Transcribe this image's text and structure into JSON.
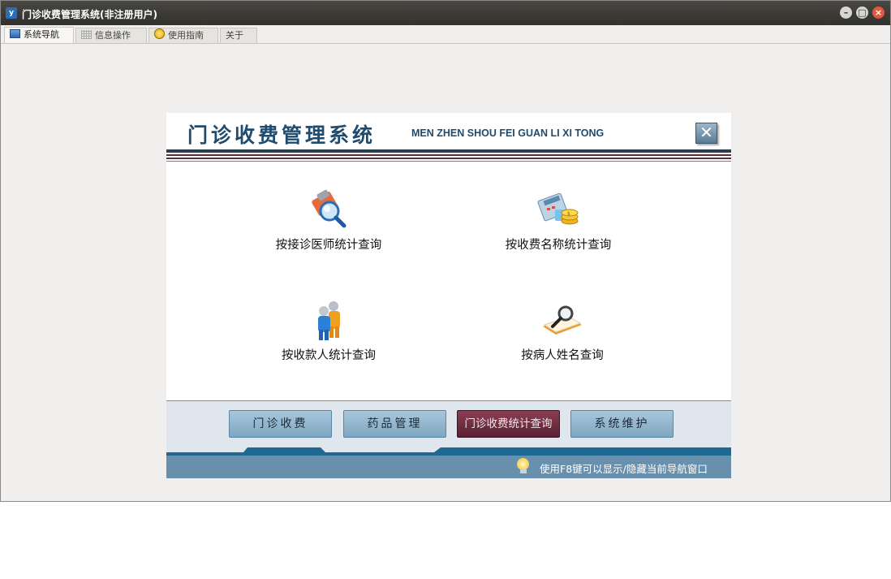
{
  "window": {
    "title": "门诊收费管理系统(非注册用户)",
    "logo_text": "y"
  },
  "tabs": [
    {
      "label": "系统导航",
      "icon": "monitor-icon",
      "active": true
    },
    {
      "label": "信息操作",
      "icon": "grid-icon",
      "active": false
    },
    {
      "label": "使用指南",
      "icon": "guide-icon",
      "active": false
    },
    {
      "label": "关于",
      "icon": "",
      "active": false
    }
  ],
  "panel": {
    "title_cn": "门诊收费管理系统",
    "title_en": "MEN ZHEN SHOU FEI GUAN LI XI TONG",
    "close_glyph": "✕",
    "queries": [
      {
        "label": "按接诊医师统计查询",
        "icon": "doctor-search-icon"
      },
      {
        "label": "按收费名称统计查询",
        "icon": "calculator-coins-icon"
      },
      {
        "label": "按收款人统计查询",
        "icon": "people-icon"
      },
      {
        "label": "按病人姓名查询",
        "icon": "magnifier-book-icon"
      }
    ],
    "nav_buttons": [
      {
        "label": "门诊收费",
        "current": false
      },
      {
        "label": "药品管理",
        "current": false
      },
      {
        "label": "门诊收费统计查询",
        "current": true
      },
      {
        "label": "系统维护",
        "current": false
      }
    ],
    "status_text": "使用F8键可以显示/隐藏当前导航窗口"
  },
  "colors": {
    "accent": "#1f4b6e",
    "status_bar": "#6890ad",
    "current_button": "#5a2034"
  }
}
